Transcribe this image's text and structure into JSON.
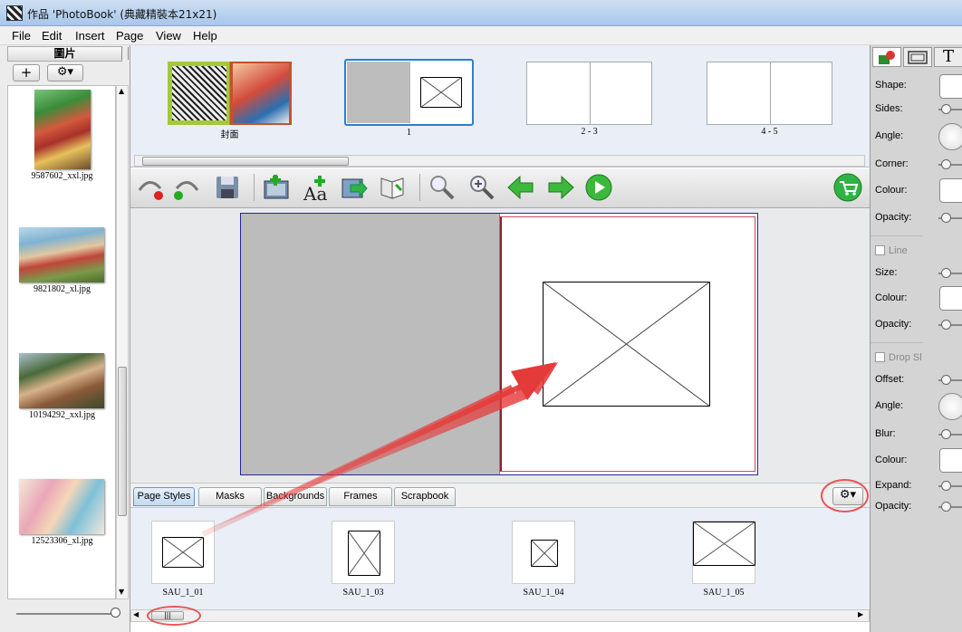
{
  "window": {
    "title": "作品 'PhotoBook' (典藏精裝本21x21)"
  },
  "menu": [
    "File",
    "Edit",
    "Insert",
    "Page",
    "View",
    "Help"
  ],
  "left_panel": {
    "header": "圖片",
    "add_label": "+",
    "photos": [
      {
        "name": "9587602_xxl.jpg"
      },
      {
        "name": "9821802_xl.jpg"
      },
      {
        "name": "10194292_xxl.jpg"
      },
      {
        "name": "12523306_xl.jpg"
      }
    ]
  },
  "page_thumbs": [
    {
      "label": "封面"
    },
    {
      "label": "1"
    },
    {
      "label": "2 - 3"
    },
    {
      "label": "4 - 5"
    }
  ],
  "toolbar": {
    "icons": [
      "undo-icon",
      "redo-icon",
      "save-icon",
      "add-photo-icon",
      "add-text-icon",
      "export-icon",
      "pages-icon",
      "zoom-out-icon",
      "zoom-in-icon",
      "arrow-left-icon",
      "arrow-right-icon",
      "play-icon",
      "cart-icon"
    ]
  },
  "style_tabs": [
    "Page Styles",
    "Masks",
    "Backgrounds",
    "Frames",
    "Scrapbook"
  ],
  "page_styles": [
    {
      "name": "SAU_1_01"
    },
    {
      "name": "SAU_1_03"
    },
    {
      "name": "SAU_1_04"
    },
    {
      "name": "SAU_1_05"
    }
  ],
  "right_panel": {
    "tool_tab_icons": [
      "shape-tool-icon",
      "frame-tool-icon",
      "text-tool-icon"
    ],
    "text_tab_glyph": "T",
    "shape_section": [
      "Shape:",
      "Sides:",
      "Angle:",
      "Corner:",
      "Colour:",
      "Opacity:"
    ],
    "line_title": "Line",
    "line_section": [
      "Size:",
      "Colour:",
      "Opacity:"
    ],
    "drop_title": "Drop Sl",
    "drop_section": [
      "Offset:",
      "Angle:",
      "Blur:",
      "Colour:",
      "Expand:",
      "Opacity:"
    ]
  },
  "colors": {
    "accent": "#2a7fd4",
    "annotation": "#e53a3a",
    "green_button": "#2fb344"
  }
}
